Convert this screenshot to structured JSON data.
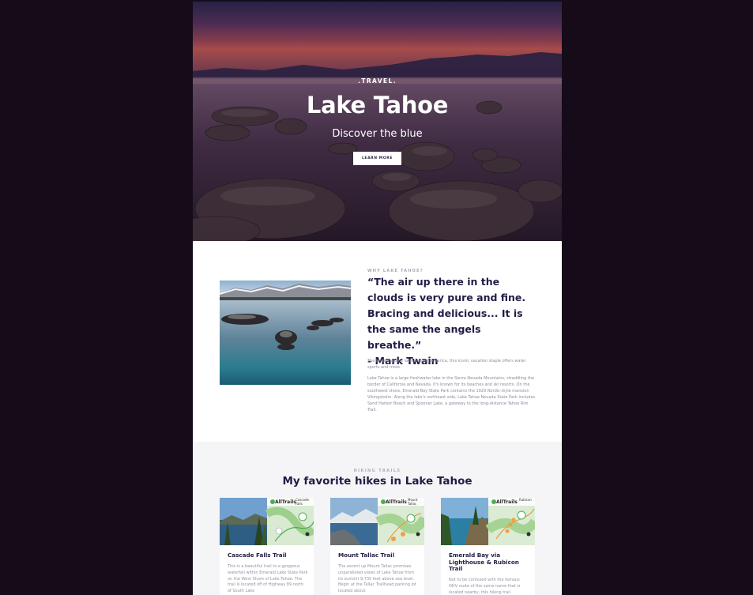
{
  "hero": {
    "eyebrow": ".TRAVEL.",
    "title": "Lake Tahoe",
    "subtitle": "Discover the blue",
    "button_label": "LEARN MORE"
  },
  "about": {
    "eyebrow": "WHY LAKE TAHOE?",
    "quote": "“The air up there in the clouds is very pure and fine. Bracing and delicious... It is the same the angels breathe.”",
    "author": "- Mark Twain",
    "p1": "The largest alpine lake in North America, this iconic vacation staple offers water sports and more.",
    "p2": "Lake Tahoe is a large freshwater lake in the Sierra Nevada Mountains, straddling the border of California and Nevada. It's known for its beaches and ski resorts. On the southwest shore, Emerald Bay State Park contains the 1929 Nordic-style mansion Vikingsholm. Along the lake's northeast side, Lake Tahoe Nevada State Park includes Sand Harbor Beach and Spooner Lake, a gateway to the long-distance Tahoe Rim Trail."
  },
  "hikes": {
    "eyebrow": "HIKING TRAILS",
    "title": "My favorite hikes in Lake Tahoe",
    "cards": [
      {
        "title": "Cascade Falls Trail",
        "desc": "This is a beautiful trail to a gorgeous waterfall within Emerald Lake State Park on the West Shore of Lake Tahoe. The trail is located off of Highway 89 north of South Lake",
        "map_brand": "AllTrails",
        "map_label": "Cascade Falls"
      },
      {
        "title": "Mount Tallac Trail",
        "desc": "The ascent up Mount Tallac promises unparalleled views of Lake Tahoe from its summit 9,735 feet above sea level. Begin at the Tallac Trailhead parking lot located about",
        "map_brand": "AllTrails",
        "map_label": "Mount Tallac"
      },
      {
        "title": "Emerald Bay via Lighthouse & Rubicon Trail",
        "desc": "Not to be confused with the famous OHV route of the same name that is located nearby, this hiking trail",
        "map_brand": "AllTrails",
        "map_label": "Rubicon"
      }
    ]
  },
  "colors": {
    "outer_bg": "#160b19",
    "heading": "#231c45",
    "body_text": "#8e8a9e",
    "section_alt_bg": "#f5f4f6",
    "map_accent": "#4caf50"
  }
}
